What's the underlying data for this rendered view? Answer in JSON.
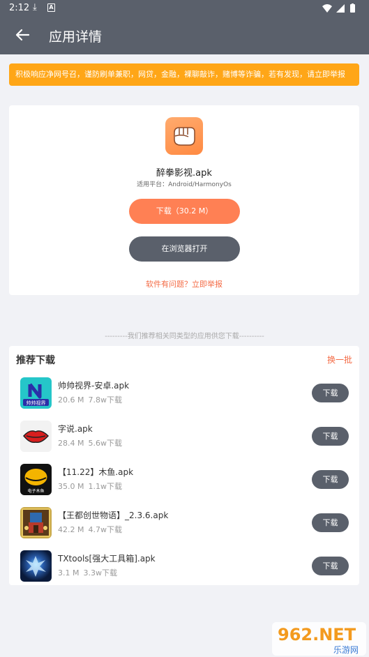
{
  "status_bar": {
    "time": "2:12"
  },
  "header": {
    "title": "应用详情"
  },
  "notice": {
    "text": "积极响应净网号召，谨防刷单兼职，网贷，金融，裸聊敲诈，赌博等诈骗，若有发现，请立即举报"
  },
  "app": {
    "name": "醉拳影视.apk",
    "platform": "适用平台：Android/HarmonyOs",
    "download_label": "下载（30.2 M）",
    "browser_label": "在浏览器打开",
    "report_label": "软件有问题？立即举报"
  },
  "divider_text": "---------我们推荐相关同类型的应用供您下载----------",
  "recommend": {
    "title": "推荐下载",
    "refresh_label": "换一批",
    "items": [
      {
        "name": "帅帅视界-安卓.apk",
        "size": "20.6 M",
        "downloads": "7.8w下载",
        "button": "下载",
        "icon_text": "帅帅视界"
      },
      {
        "name": "字说.apk",
        "size": "28.4 M",
        "downloads": "5.6w下载",
        "button": "下载"
      },
      {
        "name": "【11.22】木鱼.apk",
        "size": "35.0 M",
        "downloads": "1.1w下载",
        "button": "下载",
        "icon_text": "电子木鱼"
      },
      {
        "name": "【王都创世物语】_2.3.6.apk",
        "size": "42.2 M",
        "downloads": "4.7w下载",
        "button": "下载"
      },
      {
        "name": "TXtools[强大工具箱].apk",
        "size": "3.1 M",
        "downloads": "3.3w下载",
        "button": "下载"
      }
    ]
  },
  "watermark": {
    "brand": "962.NET",
    "sub": "乐游网"
  },
  "colors": {
    "header": "#5a606b",
    "notice": "#ffa617",
    "accent": "#ff8054",
    "link": "#f46b45"
  }
}
